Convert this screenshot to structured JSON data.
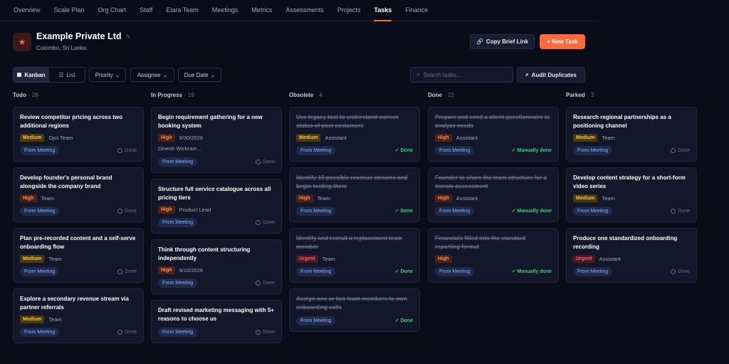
{
  "nav": {
    "tabs": [
      "Overview",
      "Scale Plan",
      "Org Chart",
      "Staff",
      "Elara Team",
      "Meetings",
      "Metrics",
      "Assessments",
      "Projects",
      "Tasks",
      "Finance"
    ],
    "active": "Tasks"
  },
  "company": {
    "name": "Example Private Ltd",
    "location": "Colombo, Sri Lanka",
    "logo_icon": "star-icon"
  },
  "header": {
    "copy_link_label": "Copy Brief Link",
    "new_task_label": "+ New Task"
  },
  "toolbar": {
    "kanban_label": "Kanban",
    "list_label": "List",
    "priority_label": "Priority",
    "assignee_label": "Assignee",
    "due_date_label": "Due Date",
    "search_placeholder": "Search tasks...",
    "audit_label": "Audit Duplicates"
  },
  "colors": {
    "accent": "#ff6a3d",
    "medium": "#f2c744",
    "high": "#ff8a5c",
    "urgent": "#ff5b6e",
    "done": "#35d07f"
  },
  "columns": [
    {
      "name": "Todo",
      "count": "28",
      "cards": [
        {
          "title": "Review competitor pricing across two additional regions",
          "priority": "Medium",
          "assignee": "Ops Team",
          "source": "From Meeting",
          "status": "Done"
        },
        {
          "title": "Develop founder's personal brand alongside the company brand",
          "priority": "High",
          "assignee": "Team",
          "source": "From Meeting",
          "status": "Done"
        },
        {
          "title": "Plan pre-recorded content and a self-serve onboarding flow",
          "priority": "Medium",
          "assignee": "Team",
          "source": "From Meeting",
          "status": "Done"
        },
        {
          "title": "Explore a secondary revenue stream via partner referrals",
          "priority": "Medium",
          "assignee": "Team",
          "source": "From Meeting",
          "status": "Done"
        }
      ]
    },
    {
      "name": "In Progress",
      "count": "19",
      "cards": [
        {
          "title": "Begin requirement gathering for a new booking system",
          "priority": "High",
          "assignee": "9/30/2026",
          "sub": "Dinesh Wickram...",
          "source": "From Meeting",
          "status": "Done"
        },
        {
          "title": "Structure full service catalogue across all pricing tiers",
          "priority": "High",
          "assignee": "Product Lead",
          "source": "From Meeting",
          "status": "Done"
        },
        {
          "title": "Think through content structuring independently",
          "priority": "High",
          "assignee": "9/10/2026",
          "source": "From Meeting",
          "status": "Done"
        },
        {
          "title": "Draft revised marketing messaging with 5+ reasons to choose us",
          "priority": "",
          "assignee": "",
          "source": "From Meeting",
          "status": "Done"
        }
      ]
    },
    {
      "name": "Obsolete",
      "count": "4",
      "cards": [
        {
          "title": "Use legacy tool to understand current status of past customers",
          "done": true,
          "priority": "Medium",
          "assignee": "Assistant",
          "source": "From Meeting",
          "status": "✓ Done"
        },
        {
          "title": "Identify 10 possible revenue streams and begin testing them",
          "done": true,
          "priority": "High",
          "assignee": "Team",
          "source": "From Meeting",
          "status": "✓ Done"
        },
        {
          "title": "Identify and recruit a replacement team member",
          "done": true,
          "priority": "Urgent",
          "assignee": "Team",
          "source": "From Meeting",
          "status": "✓ Done"
        },
        {
          "title": "Assign one or two team members to own onboarding calls",
          "done": true,
          "priority": "",
          "assignee": "",
          "source": "From Meeting",
          "status": "✓ Done"
        }
      ]
    },
    {
      "name": "Done",
      "count": "22",
      "cards": [
        {
          "title": "Prepare and send a client questionnaire to analyze needs",
          "done": true,
          "priority": "High",
          "assignee": "Assistant",
          "source": "From Meeting",
          "status": "✓ Manually done"
        },
        {
          "title": "Founder to share the team structure for a morale assessment",
          "done": true,
          "priority": "High",
          "assignee": "Assistant",
          "source": "From Meeting",
          "status": "✓ Manually done"
        },
        {
          "title": "Financials filled into the standard reporting format",
          "done": true,
          "priority": "High",
          "assignee": "",
          "source": "From Meeting",
          "status": "✓ Manually done"
        }
      ]
    },
    {
      "name": "Parked",
      "count": "3",
      "cards": [
        {
          "title": "Research regional partnerships as a positioning channel",
          "priority": "Medium",
          "assignee": "Team",
          "source": "From Meeting",
          "status": "Done"
        },
        {
          "title": "Develop content strategy for a short-form video series",
          "priority": "Medium",
          "assignee": "Team",
          "source": "From Meeting",
          "status": "Done"
        },
        {
          "title": "Produce one standardized onboarding recording",
          "priority": "Urgent",
          "assignee": "Assistant",
          "source": "From Meeting",
          "status": "Done"
        }
      ]
    }
  ]
}
